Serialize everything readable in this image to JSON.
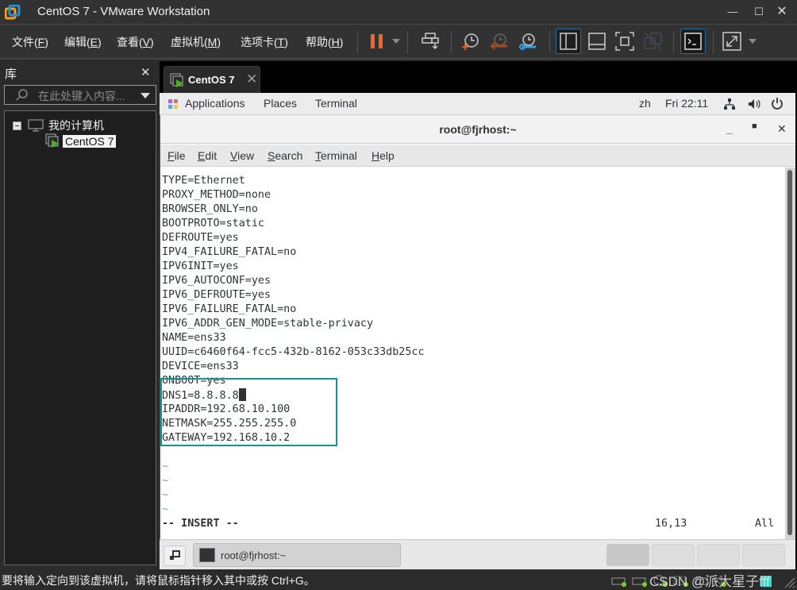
{
  "window": {
    "title": "CentOS 7 - VMware Workstation",
    "controls": [
      "minimize",
      "maximize",
      "close"
    ]
  },
  "menubar": {
    "items": [
      {
        "label": "文件",
        "key": "F"
      },
      {
        "label": "编辑",
        "key": "E"
      },
      {
        "label": "查看",
        "key": "V"
      },
      {
        "label": "虚拟机",
        "key": "M"
      },
      {
        "label": "选项卡",
        "key": "T"
      },
      {
        "label": "帮助",
        "key": "H"
      }
    ],
    "toolbar": [
      "pause-icon",
      "send-ctrl-alt-del-icon",
      "take-snapshot-icon",
      "revert-snapshot-icon",
      "snapshot-manager-icon",
      "show-library-icon",
      "show-thumbnail-icon",
      "full-screen-icon",
      "unity-icon",
      "console-view-icon",
      "stretch-guest-icon"
    ],
    "colors": {
      "pause": "#f26522",
      "snapshot_manager": "#2ea0e6",
      "accent_border": "#2c6a9a"
    }
  },
  "library": {
    "title": "库",
    "search_placeholder": "在此处键入内容...",
    "tree": {
      "root_label": "我的计算机",
      "children": [
        {
          "label": "CentOS 7",
          "selected": true
        }
      ]
    }
  },
  "vm_tab": {
    "label": "CentOS 7"
  },
  "gnome_panel": {
    "applications": "Applications",
    "places": "Places",
    "terminal": "Terminal",
    "input_method": "zh",
    "clock": "Fri 22:11"
  },
  "terminal": {
    "title": "root@fjrhost:~",
    "menu": [
      {
        "label": "File",
        "key": "F"
      },
      {
        "label": "Edit",
        "key": "E"
      },
      {
        "label": "View",
        "key": "V"
      },
      {
        "label": "Search",
        "key": "S"
      },
      {
        "label": "Terminal",
        "key": "T"
      },
      {
        "label": "Help",
        "key": "H"
      }
    ],
    "lines": [
      "TYPE=Ethernet",
      "PROXY_METHOD=none",
      "BROWSER_ONLY=no",
      "BOOTPROTO=static",
      "DEFROUTE=yes",
      "IPV4_FAILURE_FATAL=no",
      "IPV6INIT=yes",
      "IPV6_AUTOCONF=yes",
      "IPV6_DEFROUTE=yes",
      "IPV6_FAILURE_FATAL=no",
      "IPV6_ADDR_GEN_MODE=stable-privacy",
      "NAME=ens33",
      "UUID=c6460f64-fcc5-432b-8162-053c33db25cc",
      "DEVICE=ens33",
      "ONBOOT=yes",
      "DNS1=8.8.8.8",
      "IPADDR=192.68.10.100",
      "NETMASK=255.255.255.0",
      "GATEWAY=192.168.10.2"
    ],
    "empty_line_marker": "~",
    "empty_lines": 4,
    "mode": "-- INSERT --",
    "cursor_position": "16,13",
    "scroll_position": "All",
    "highlight_color": "#149490"
  },
  "gnome_bottom": {
    "task_label": "root@fjrhost:~",
    "workspaces": 4,
    "active_workspace": 1
  },
  "statusbar": {
    "message": "要将输入定向到该虚拟机，请将鼠标指针移入其中或按 Ctrl+G。",
    "watermark": "CSDN @派大星子fff"
  }
}
